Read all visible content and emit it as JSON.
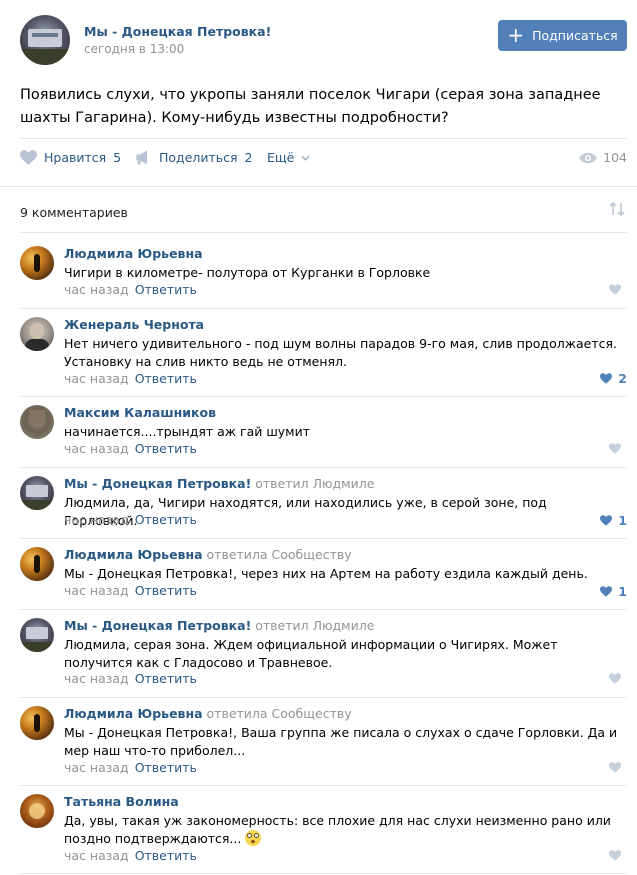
{
  "post": {
    "group_name": "Мы - Донецкая Петровка!",
    "date": "сегодня в 13:00",
    "subscribe_label": "Подписаться",
    "text": "Появились слухи, что укропы заняли поселок Чигари (серая зона западнее шахты Гагарина). Кому-нибудь известны подробности?",
    "like_label": "Нравится",
    "like_count": "5",
    "share_label": "Поделиться",
    "share_count": "2",
    "more_label": "Ещё",
    "views": "104"
  },
  "comments_header": "9 комментариев",
  "comments": [
    {
      "author": "Людмила Юрьевна",
      "replied": "",
      "text": "Чигири в километре- полутора от Курганки в Горловке",
      "time": "час назад",
      "reply": "Ответить",
      "likes": ""
    },
    {
      "author": "Женераль Чернота",
      "replied": "",
      "text": "Нет ничего удивительного - под шум волны парадов 9-го мая, слив продолжается. Установку на слив никто ведь не отменял.",
      "time": "час назад",
      "reply": "Ответить",
      "likes": "2"
    },
    {
      "author": "Максим Калашников",
      "replied": "",
      "text": "начинается....трындят аж гай шумит",
      "time": "час назад",
      "reply": "Ответить",
      "likes": ""
    },
    {
      "author": "Мы - Донецкая Петровка!",
      "replied": " ответил Людмиле",
      "text": "Людмила, да, Чигири находятся, или находились уже, в серой зоне, под Горловкой.",
      "time": "час назад",
      "reply": "Ответить",
      "likes": "1"
    },
    {
      "author": "Людмила Юрьевна",
      "replied": " ответила Сообществу",
      "text": "Мы - Донецкая Петровка!, через них на Артем на работу ездила каждый день.",
      "time": "час назад",
      "reply": "Ответить",
      "likes": "1"
    },
    {
      "author": "Мы - Донецкая Петровка!",
      "replied": " ответил Людмиле",
      "text": "Людмила, серая зона. Ждем официальной информации о Чигирях. Может получится как с Гладосово и Травневое.",
      "time": "час назад",
      "reply": "Ответить",
      "likes": ""
    },
    {
      "author": "Людмила Юрьевна",
      "replied": " ответила Сообществу",
      "text": "Мы - Донецкая Петровка!, Ваша группа же писала о слухах о сдаче Горловки. Да и мер наш что-то приболел...",
      "time": "час назад",
      "reply": "Ответить",
      "likes": ""
    },
    {
      "author": "Татьяна Волина",
      "replied": "",
      "text": "Да, увы, такая уж закономерность: все плохие для нас слухи неизменно рано или поздно подтверждаются...",
      "time": "час назад",
      "reply": "Ответить",
      "likes": ""
    }
  ]
}
